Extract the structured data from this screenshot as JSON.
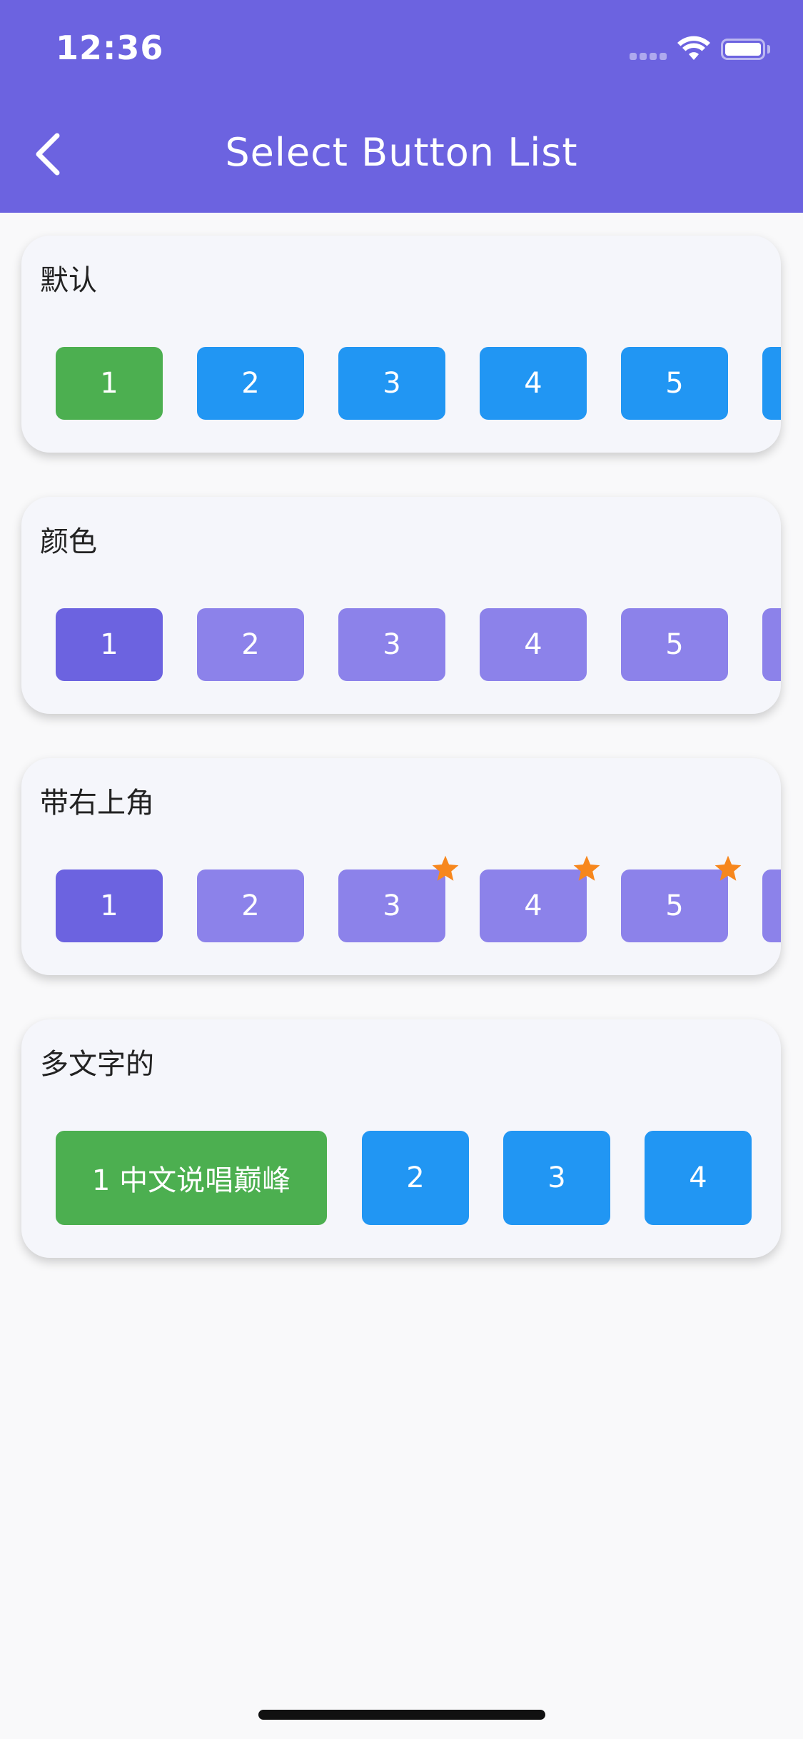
{
  "status_bar": {
    "time": "12:36"
  },
  "nav": {
    "title": "Select Button List",
    "back_icon": "chevron-left-icon"
  },
  "colors": {
    "header": "#6c63e0",
    "blue": "#2196f3",
    "green": "#4caf50",
    "purple_selected": "#6c63e0",
    "purple": "#8c82ea",
    "star": "#f7871d"
  },
  "cards": [
    {
      "title": "默认",
      "buttons": [
        "1",
        "2",
        "3",
        "4",
        "5"
      ]
    },
    {
      "title": "颜色",
      "buttons": [
        "1",
        "2",
        "3",
        "4",
        "5"
      ]
    },
    {
      "title": "带右上角",
      "buttons": [
        "1",
        "2",
        "3",
        "4",
        "5"
      ],
      "badge_icon": "star-icon"
    },
    {
      "title": "多文字的",
      "buttons": [
        "1 中文说唱巅峰",
        "2",
        "3",
        "4"
      ]
    }
  ]
}
